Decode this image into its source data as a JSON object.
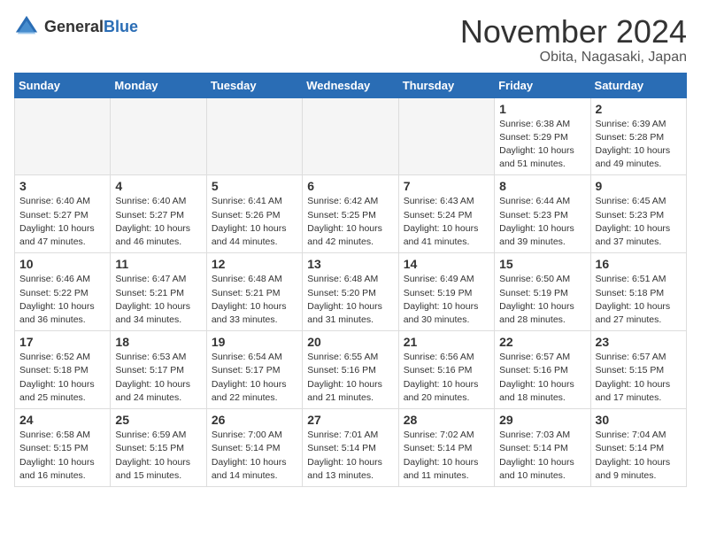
{
  "header": {
    "logo_general": "General",
    "logo_blue": "Blue",
    "month": "November 2024",
    "location": "Obita, Nagasaki, Japan"
  },
  "weekdays": [
    "Sunday",
    "Monday",
    "Tuesday",
    "Wednesday",
    "Thursday",
    "Friday",
    "Saturday"
  ],
  "weeks": [
    [
      {
        "day": "",
        "info": ""
      },
      {
        "day": "",
        "info": ""
      },
      {
        "day": "",
        "info": ""
      },
      {
        "day": "",
        "info": ""
      },
      {
        "day": "",
        "info": ""
      },
      {
        "day": "1",
        "info": "Sunrise: 6:38 AM\nSunset: 5:29 PM\nDaylight: 10 hours\nand 51 minutes."
      },
      {
        "day": "2",
        "info": "Sunrise: 6:39 AM\nSunset: 5:28 PM\nDaylight: 10 hours\nand 49 minutes."
      }
    ],
    [
      {
        "day": "3",
        "info": "Sunrise: 6:40 AM\nSunset: 5:27 PM\nDaylight: 10 hours\nand 47 minutes."
      },
      {
        "day": "4",
        "info": "Sunrise: 6:40 AM\nSunset: 5:27 PM\nDaylight: 10 hours\nand 46 minutes."
      },
      {
        "day": "5",
        "info": "Sunrise: 6:41 AM\nSunset: 5:26 PM\nDaylight: 10 hours\nand 44 minutes."
      },
      {
        "day": "6",
        "info": "Sunrise: 6:42 AM\nSunset: 5:25 PM\nDaylight: 10 hours\nand 42 minutes."
      },
      {
        "day": "7",
        "info": "Sunrise: 6:43 AM\nSunset: 5:24 PM\nDaylight: 10 hours\nand 41 minutes."
      },
      {
        "day": "8",
        "info": "Sunrise: 6:44 AM\nSunset: 5:23 PM\nDaylight: 10 hours\nand 39 minutes."
      },
      {
        "day": "9",
        "info": "Sunrise: 6:45 AM\nSunset: 5:23 PM\nDaylight: 10 hours\nand 37 minutes."
      }
    ],
    [
      {
        "day": "10",
        "info": "Sunrise: 6:46 AM\nSunset: 5:22 PM\nDaylight: 10 hours\nand 36 minutes."
      },
      {
        "day": "11",
        "info": "Sunrise: 6:47 AM\nSunset: 5:21 PM\nDaylight: 10 hours\nand 34 minutes."
      },
      {
        "day": "12",
        "info": "Sunrise: 6:48 AM\nSunset: 5:21 PM\nDaylight: 10 hours\nand 33 minutes."
      },
      {
        "day": "13",
        "info": "Sunrise: 6:48 AM\nSunset: 5:20 PM\nDaylight: 10 hours\nand 31 minutes."
      },
      {
        "day": "14",
        "info": "Sunrise: 6:49 AM\nSunset: 5:19 PM\nDaylight: 10 hours\nand 30 minutes."
      },
      {
        "day": "15",
        "info": "Sunrise: 6:50 AM\nSunset: 5:19 PM\nDaylight: 10 hours\nand 28 minutes."
      },
      {
        "day": "16",
        "info": "Sunrise: 6:51 AM\nSunset: 5:18 PM\nDaylight: 10 hours\nand 27 minutes."
      }
    ],
    [
      {
        "day": "17",
        "info": "Sunrise: 6:52 AM\nSunset: 5:18 PM\nDaylight: 10 hours\nand 25 minutes."
      },
      {
        "day": "18",
        "info": "Sunrise: 6:53 AM\nSunset: 5:17 PM\nDaylight: 10 hours\nand 24 minutes."
      },
      {
        "day": "19",
        "info": "Sunrise: 6:54 AM\nSunset: 5:17 PM\nDaylight: 10 hours\nand 22 minutes."
      },
      {
        "day": "20",
        "info": "Sunrise: 6:55 AM\nSunset: 5:16 PM\nDaylight: 10 hours\nand 21 minutes."
      },
      {
        "day": "21",
        "info": "Sunrise: 6:56 AM\nSunset: 5:16 PM\nDaylight: 10 hours\nand 20 minutes."
      },
      {
        "day": "22",
        "info": "Sunrise: 6:57 AM\nSunset: 5:16 PM\nDaylight: 10 hours\nand 18 minutes."
      },
      {
        "day": "23",
        "info": "Sunrise: 6:57 AM\nSunset: 5:15 PM\nDaylight: 10 hours\nand 17 minutes."
      }
    ],
    [
      {
        "day": "24",
        "info": "Sunrise: 6:58 AM\nSunset: 5:15 PM\nDaylight: 10 hours\nand 16 minutes."
      },
      {
        "day": "25",
        "info": "Sunrise: 6:59 AM\nSunset: 5:15 PM\nDaylight: 10 hours\nand 15 minutes."
      },
      {
        "day": "26",
        "info": "Sunrise: 7:00 AM\nSunset: 5:14 PM\nDaylight: 10 hours\nand 14 minutes."
      },
      {
        "day": "27",
        "info": "Sunrise: 7:01 AM\nSunset: 5:14 PM\nDaylight: 10 hours\nand 13 minutes."
      },
      {
        "day": "28",
        "info": "Sunrise: 7:02 AM\nSunset: 5:14 PM\nDaylight: 10 hours\nand 11 minutes."
      },
      {
        "day": "29",
        "info": "Sunrise: 7:03 AM\nSunset: 5:14 PM\nDaylight: 10 hours\nand 10 minutes."
      },
      {
        "day": "30",
        "info": "Sunrise: 7:04 AM\nSunset: 5:14 PM\nDaylight: 10 hours\nand 9 minutes."
      }
    ]
  ]
}
